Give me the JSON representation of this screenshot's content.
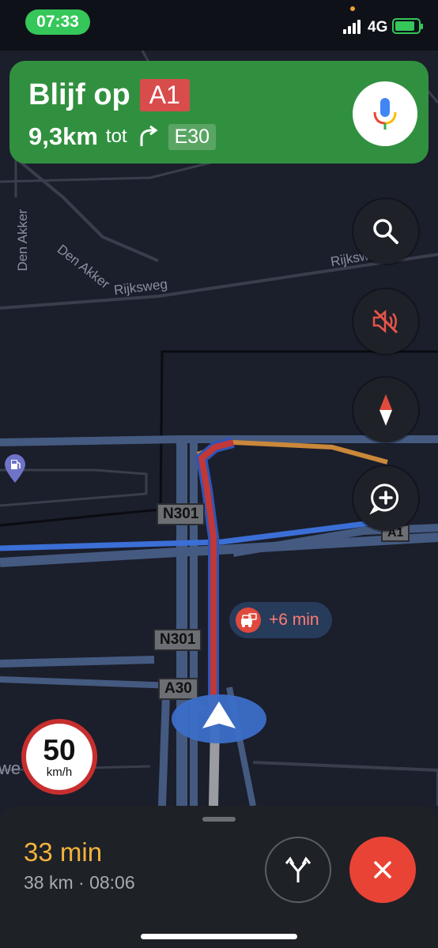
{
  "status_bar": {
    "time": "07:33",
    "network": "4G"
  },
  "banner": {
    "verb": "Blijf op",
    "road": "A1",
    "distance": "9,3km",
    "connector": "tot",
    "next_road": "E30"
  },
  "map": {
    "street_labels": [
      "Den Akker",
      "Den Akker",
      "Rijksweg",
      "Rijksw",
      "we"
    ],
    "road_shields": [
      "N301",
      "N301",
      "A30",
      "A1"
    ]
  },
  "traffic": {
    "delay": "+6 min"
  },
  "speed_limit": {
    "value": "50",
    "unit": "km/h"
  },
  "trip": {
    "duration": "33 min",
    "details": "38 km · 08:06"
  },
  "colors": {
    "banner": "#31903f",
    "eta": "#f3b33d",
    "route_traffic": "#d94c4c",
    "route_alt": "#3b6fd6",
    "close": "#e94335"
  },
  "icons": [
    "mic-icon",
    "search-icon",
    "mute-icon",
    "compass-icon",
    "add-report-icon",
    "alt-routes-icon",
    "close-icon",
    "traffic-car-icon",
    "gas-station-icon",
    "position-arrow-icon"
  ]
}
